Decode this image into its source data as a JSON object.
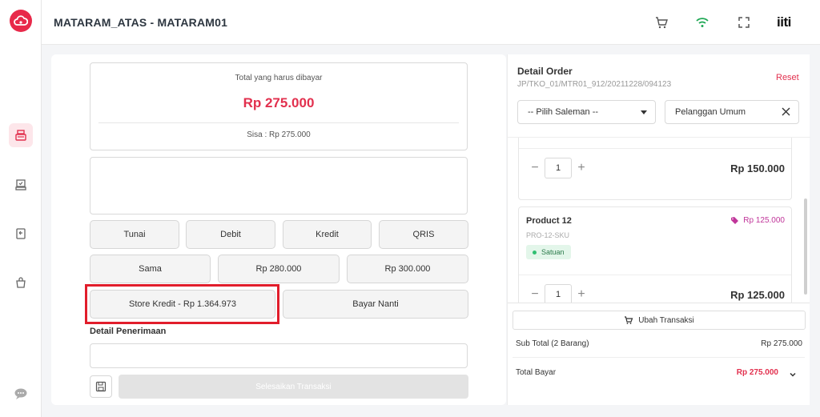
{
  "header": {
    "title": "MATARAM_ATAS - MATARAM01",
    "brand": "iiti",
    "icons": [
      "cart-icon",
      "wifi-icon",
      "fullscreen-icon"
    ]
  },
  "sidebar": {
    "items": [
      "cashier-icon",
      "pos-monitor-icon",
      "return-icon",
      "shopping-bag-icon",
      "chat-icon"
    ],
    "active": "cashier-icon"
  },
  "payment": {
    "total_label": "Total yang harus dibayar",
    "total_value": "Rp 275.000",
    "remaining": "Sisa : Rp 275.000",
    "methods": [
      "Tunai",
      "Debit",
      "Kredit",
      "QRIS"
    ],
    "amounts": [
      "Sama",
      "Rp 280.000",
      "Rp 300.000"
    ],
    "store_credit": "Store Kredit - Rp 1.364.973",
    "pay_later": "Bayar Nanti",
    "receipt_label": "Detail Penerimaan",
    "finish_label": "Selesaikan Transaksi"
  },
  "order": {
    "title": "Detail Order",
    "code": "JP/TKO_01/MTR01_912/20211228/094123",
    "reset": "Reset",
    "salesman_select": "-- Pilih Saleman --",
    "customer": "Pelanggan Umum",
    "items": [
      {
        "qty": "1",
        "price": "Rp 150.000"
      },
      {
        "name": "Product 12",
        "sku": "PRO-12-SKU",
        "tag_price": "Rp 125.000",
        "unit": "Satuan",
        "qty": "1",
        "price": "Rp 125.000"
      }
    ],
    "edit_button": "Ubah Transaksi",
    "subtotal_label": "Sub Total (2 Barang)",
    "subtotal_value": "Rp 275.000",
    "total_label": "Total Bayar",
    "total_value": "Rp 275.000"
  },
  "colors": {
    "accent": "#e2304e",
    "highlight_border": "#e11d2b",
    "wifi": "#1fa855",
    "unit_badge": "#2fbf71"
  }
}
